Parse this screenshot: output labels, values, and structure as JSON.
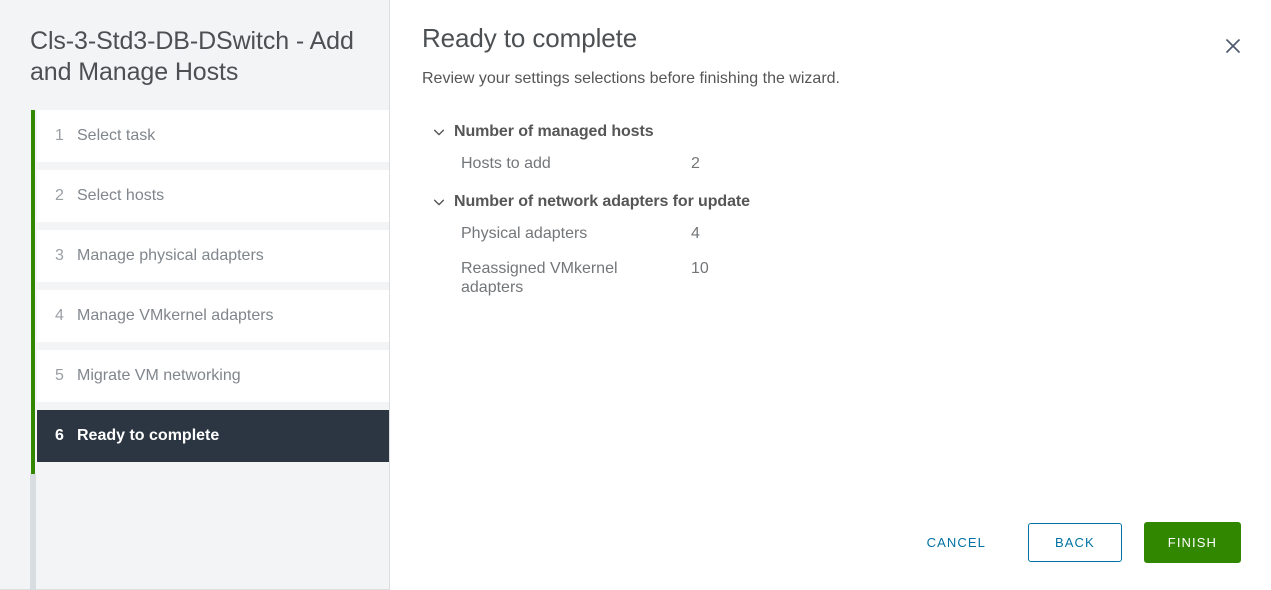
{
  "sidebar": {
    "title": "Cls-3-Std3-DB-DSwitch - Add and Manage Hosts",
    "steps": [
      {
        "num": "1",
        "label": "Select task",
        "state": "done"
      },
      {
        "num": "2",
        "label": "Select hosts",
        "state": "done"
      },
      {
        "num": "3",
        "label": "Manage physical adapters",
        "state": "done"
      },
      {
        "num": "4",
        "label": "Manage VMkernel adapters",
        "state": "done"
      },
      {
        "num": "5",
        "label": "Migrate VM networking",
        "state": "done"
      },
      {
        "num": "6",
        "label": "Ready to complete",
        "state": "active"
      }
    ]
  },
  "main": {
    "title": "Ready to complete",
    "subtitle": "Review your settings selections before finishing the wizard.",
    "close_icon": "close-icon",
    "sections": [
      {
        "title": "Number of managed hosts",
        "expanded": true,
        "chevron_icon": "chevron-down-icon",
        "rows": [
          {
            "label": "Hosts to add",
            "value": "2"
          }
        ]
      },
      {
        "title": "Number of network adapters for update",
        "expanded": true,
        "chevron_icon": "chevron-down-icon",
        "rows": [
          {
            "label": "Physical adapters",
            "value": "4"
          },
          {
            "label": "Reassigned VMkernel adapters",
            "value": "10"
          }
        ]
      }
    ]
  },
  "footer": {
    "cancel_label": "CANCEL",
    "back_label": "BACK",
    "finish_label": "FINISH"
  },
  "colors": {
    "progress_green": "#318700",
    "progress_remaining": "#d8dde1",
    "active_step_bg": "#2b3642",
    "link_blue": "#0072a3",
    "finish_green": "#318700",
    "sidebar_bg": "#f3f4f6"
  }
}
